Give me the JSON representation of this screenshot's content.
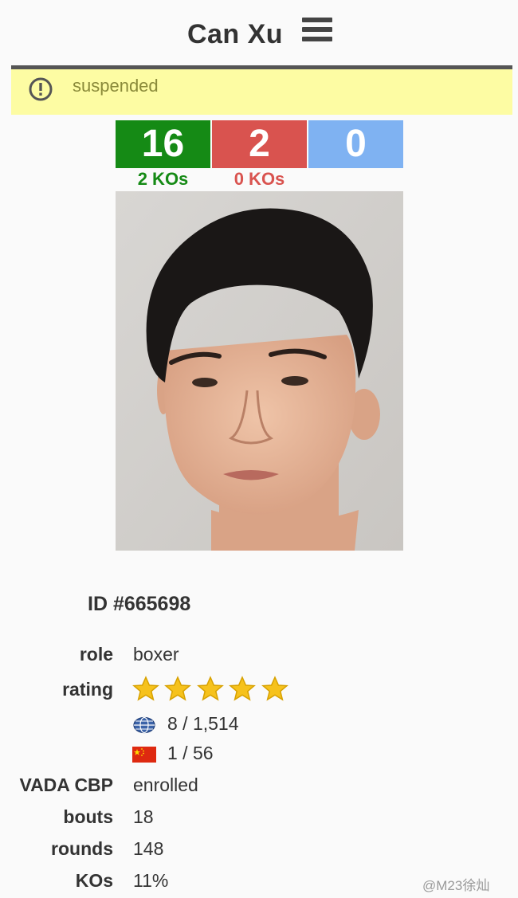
{
  "header": {
    "title": "Can Xu"
  },
  "alert": {
    "status": "suspended"
  },
  "record": {
    "wins": "16",
    "losses": "2",
    "draws": "0",
    "win_kos": "2 KOs",
    "loss_kos": "0 KOs"
  },
  "colors": {
    "win": "#158a15",
    "loss": "#d9534f",
    "draw": "#7fb2f2",
    "alert_bg": "#fdfca3"
  },
  "profile": {
    "id": "ID #665698",
    "fields": {
      "role_label": "role",
      "role": "boxer",
      "rating_label": "rating",
      "stars": 5,
      "world_rank": "8 / 1,514",
      "national_rank": "1 / 56",
      "vada_label": "VADA CBP",
      "vada": "enrolled",
      "bouts_label": "bouts",
      "bouts": "18",
      "rounds_label": "rounds",
      "rounds": "148",
      "kos_label": "KOs",
      "kos": "11%"
    }
  },
  "watermark": "@M23徐灿"
}
